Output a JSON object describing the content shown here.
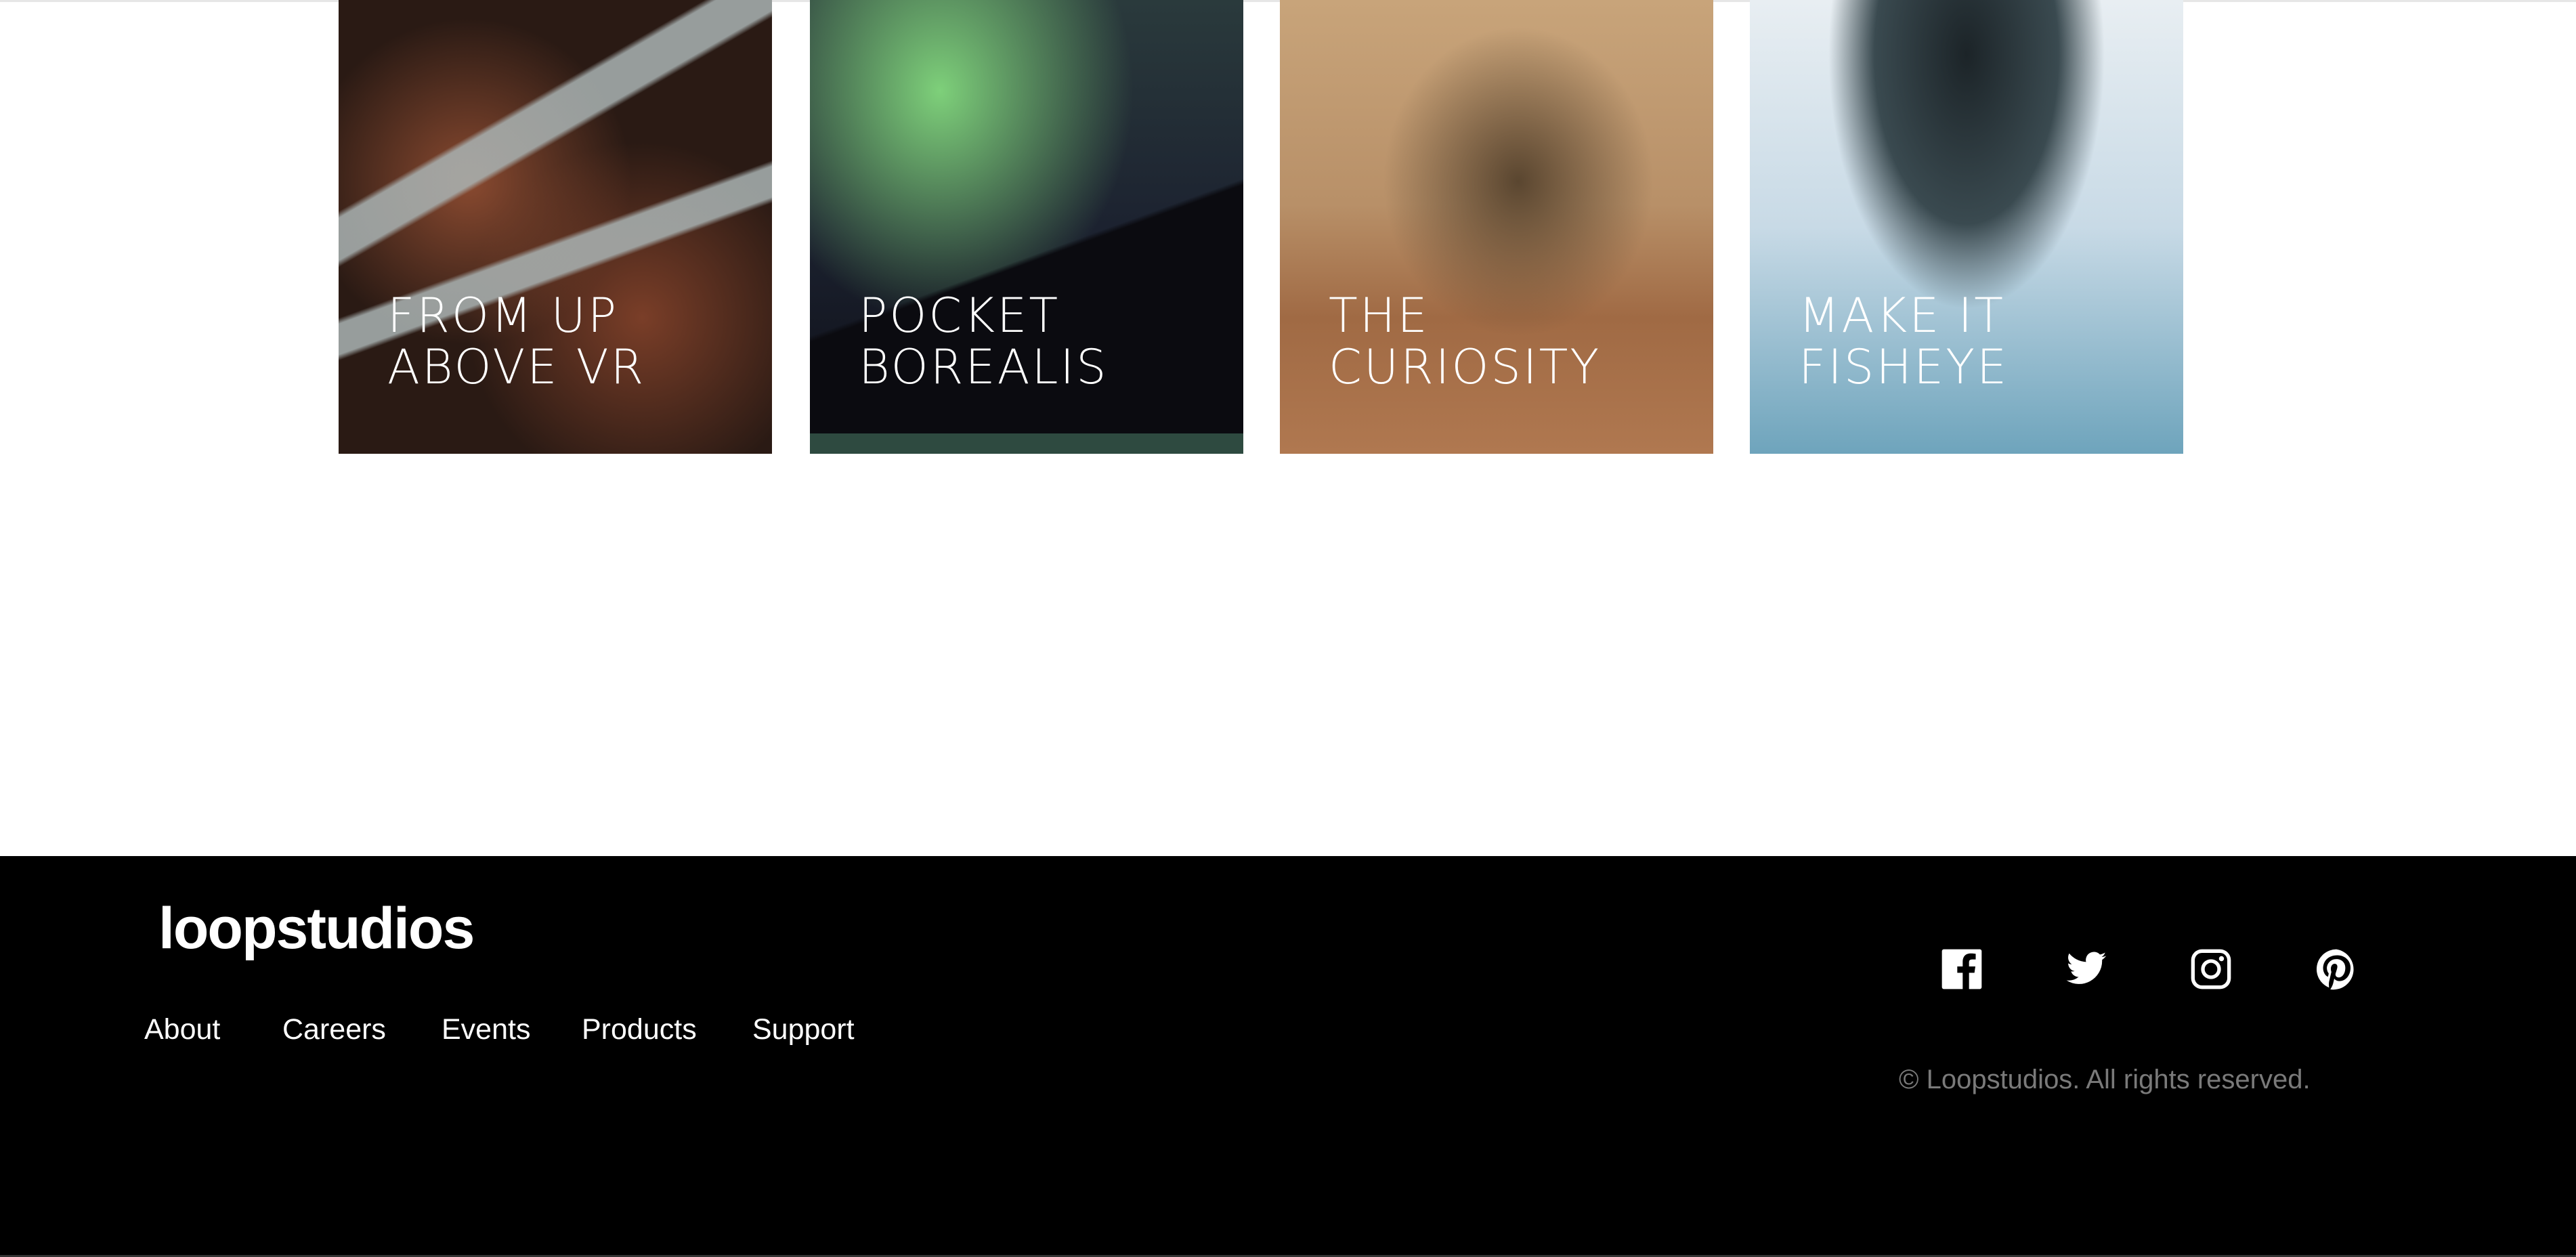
{
  "creations": [
    {
      "title": "From up\nabove VR"
    },
    {
      "title": "Pocket\nborealis"
    },
    {
      "title": "The\ncuriosity"
    },
    {
      "title": "Make it\nfisheye"
    }
  ],
  "footer": {
    "logo": "loopstudios",
    "nav": [
      "About",
      "Careers",
      "Events",
      "Products",
      "Support"
    ],
    "social": [
      "facebook-icon",
      "twitter-icon",
      "instagram-icon",
      "pinterest-icon"
    ],
    "copyright": "© Loopstudios. All rights reserved."
  },
  "colors": {
    "footer_bg": "#000000",
    "copyright": "#7a7a7a"
  }
}
